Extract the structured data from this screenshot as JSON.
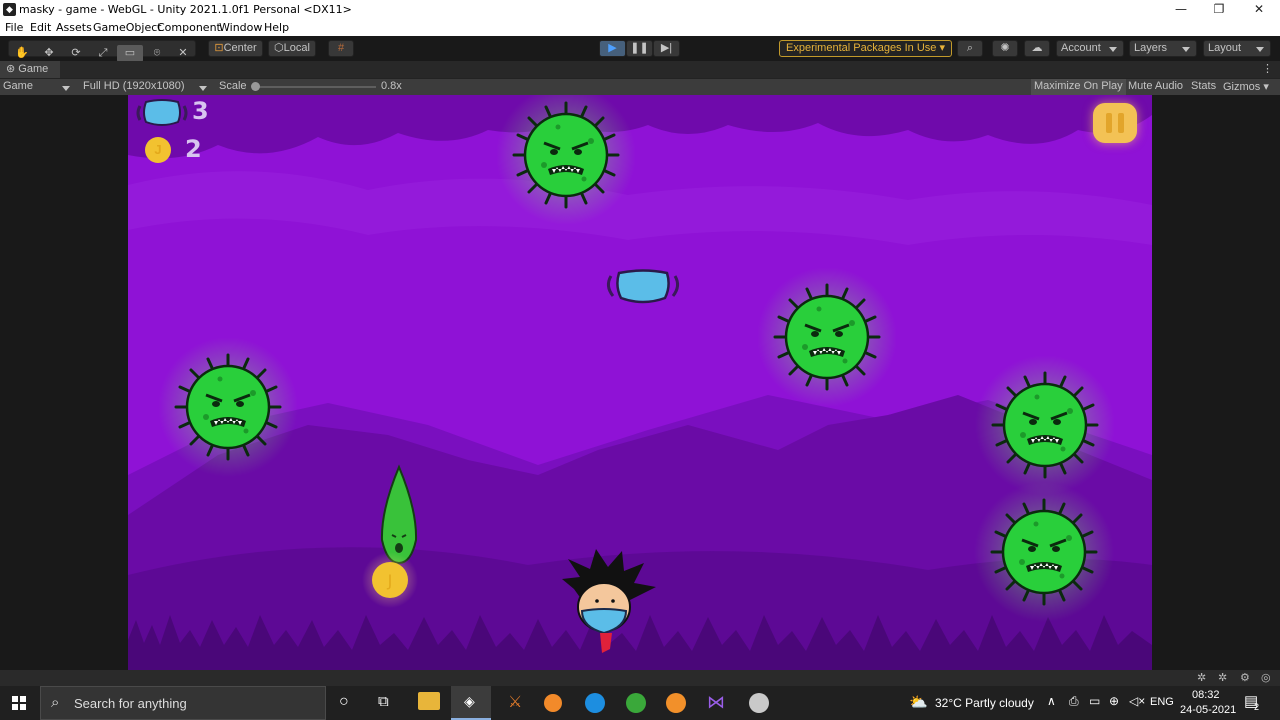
{
  "window": {
    "title": "masky - game - WebGL - Unity 2021.1.0f1 Personal <DX11>"
  },
  "menu": {
    "items": [
      "File",
      "Edit",
      "Assets",
      "GameObject",
      "Component",
      "Window",
      "Help"
    ]
  },
  "toolbar": {
    "pivot_label": "Center",
    "space_label": "Local",
    "packages_label": "Experimental Packages In Use",
    "account_label": "Account",
    "layers_label": "Layers",
    "layout_label": "Layout"
  },
  "tab": {
    "label": "Game"
  },
  "gamebar": {
    "display_label": "Game",
    "resolution_label": "Full HD (1920x1080)",
    "scale_label": "Scale",
    "scale_value": "0.8x",
    "maximize_label": "Maximize On Play",
    "mute_label": "Mute Audio",
    "stats_label": "Stats",
    "gizmos_label": "Gizmos"
  },
  "hud": {
    "masks_count": "3",
    "coins_count": "2",
    "coin_symbol": "J"
  },
  "taskbar": {
    "search_placeholder": "Search for anything",
    "weather": "32°C  Partly cloudy",
    "language": "ENG",
    "time": "08:32",
    "date": "24-05-2021",
    "notification_count": "2"
  },
  "colors": {
    "sky": "#8f12d6",
    "mountain_far": "#7a0fbf",
    "mountain_near": "#6a0ba6",
    "virus": "#29cf3b",
    "mask": "#5bbde8",
    "coin": "#f2c230",
    "pause": "#f3c255"
  }
}
